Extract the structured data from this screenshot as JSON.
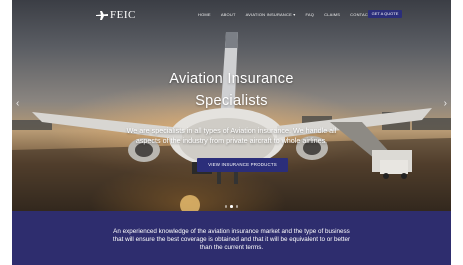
{
  "nav": {
    "logo": "FEIC",
    "items": [
      {
        "label": "HOME"
      },
      {
        "label": "ABOUT"
      },
      {
        "label": "AVIATION INSURANCE ▾"
      },
      {
        "label": "FAQ"
      },
      {
        "label": "CLAIMS"
      },
      {
        "label": "CONTACT"
      }
    ],
    "quote_button": "GET A QUOTE"
  },
  "hero": {
    "title_line1": "Aviation Insurance",
    "title_line2": "Specialists",
    "subtitle_line1": "We are specialists in all types of Aviation insurance. We handle all",
    "subtitle_line2": "aspects of the industry from private aircraft to whole airlines.",
    "cta": "VIEW INSURANCE PRODUCTS",
    "prev_arrow": "‹",
    "next_arrow": "›",
    "slides": 3,
    "active_slide": 2
  },
  "band": {
    "line1": "An experienced knowledge of the aviation insurance market and the type of business",
    "line2": "that will ensure the best coverage is obtained and that it will be equivalent to or better",
    "line3": "than the current terms."
  },
  "colors": {
    "brand_navy": "#2e2d6e",
    "button_blue": "#2b2e7a"
  },
  "icons": [
    "plane-logo-icon",
    "chevron-left-icon",
    "chevron-right-icon"
  ]
}
